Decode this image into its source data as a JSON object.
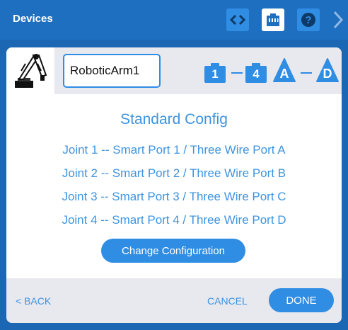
{
  "topbar": {
    "title": "Devices",
    "icons": [
      "code-icon",
      "port-icon",
      "help-icon",
      "chevron-right-icon"
    ]
  },
  "device": {
    "thumbnail_icon": "robotic-arm-icon",
    "name_value": "RoboticArm1",
    "smart_port_range": {
      "from": "1",
      "to": "4"
    },
    "three_wire_range": {
      "from": "A",
      "to": "D"
    }
  },
  "config": {
    "title": "Standard Config",
    "joints": [
      "Joint 1 -- Smart Port 1 / Three Wire Port A",
      "Joint 2 -- Smart Port 2 / Three Wire Port B",
      "Joint 3 -- Smart Port 3 / Three Wire Port C",
      "Joint 4 -- Smart Port 4 / Three Wire Port D"
    ],
    "change_button": "Change Configuration"
  },
  "footer": {
    "back": "< BACK",
    "cancel": "CANCEL",
    "done": "DONE"
  },
  "colors": {
    "background": "#1b67b4",
    "accent": "#2f8de4",
    "text_blue": "#3d94e0",
    "panel_gray": "#e8e8ef"
  }
}
